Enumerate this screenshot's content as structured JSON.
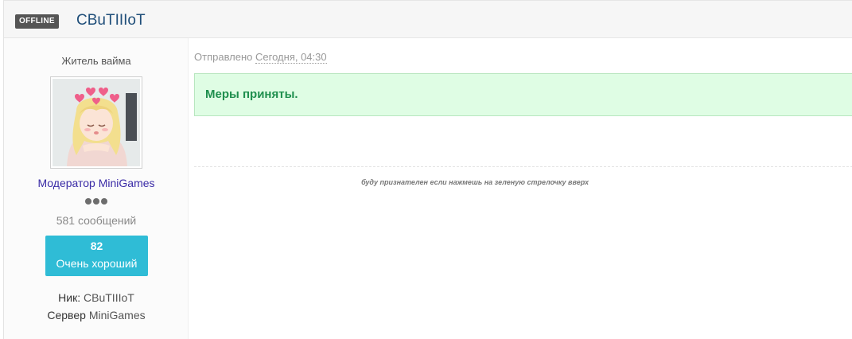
{
  "post": {
    "header": {
      "status_badge": "OFFLINE",
      "author_name": "CBuTIIIoT"
    },
    "author": {
      "user_title": "Житель вайма",
      "avatar_icon": "anime-girl-avatar",
      "group": "Модератор MiniGames",
      "rank_dots": 3,
      "post_count": "581 сообщений",
      "reputation": {
        "value": "82",
        "label": "Очень хороший",
        "color": "#2fbcd6"
      },
      "fields": {
        "nick_label": "Ник:",
        "nick_value": "CBuTIIIoT",
        "server_label": "Сервер",
        "server_value": "MiniGames"
      }
    },
    "body": {
      "date_prefix": "Отправлено",
      "date_value": "Сегодня, 04:30",
      "quote_text": "Меры приняты.",
      "signature": "буду признателен если нажмешь на зеленую стрелочку вверх"
    }
  }
}
